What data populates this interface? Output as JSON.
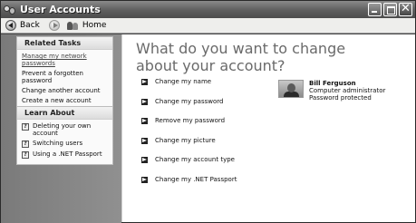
{
  "window": {
    "title": "User Accounts"
  },
  "toolbar": {
    "back_label": "Back",
    "home_label": "Home"
  },
  "sidebar": {
    "related_tasks": {
      "header": "Related Tasks",
      "items": [
        "Manage my network passwords",
        "Prevent a forgotten password",
        "Change another account",
        "Create a new account"
      ]
    },
    "learn_about": {
      "header": "Learn About",
      "items": [
        "Deleting your own account",
        "Switching users",
        "Using a .NET Passport"
      ]
    }
  },
  "main": {
    "heading": "What do you want to change about your account?",
    "options": [
      "Change my name",
      "Change my password",
      "Remove my password",
      "Change my picture",
      "Change my account type",
      "Change my .NET Passport"
    ]
  },
  "user": {
    "name": "Bill Ferguson",
    "type": "Computer administrator",
    "status": "Password protected"
  },
  "icons": [
    "user-accounts-icon",
    "back-icon",
    "forward-icon",
    "home-icon",
    "minimize-icon",
    "maximize-icon",
    "close-icon",
    "help-icon",
    "arrow-icon"
  ]
}
